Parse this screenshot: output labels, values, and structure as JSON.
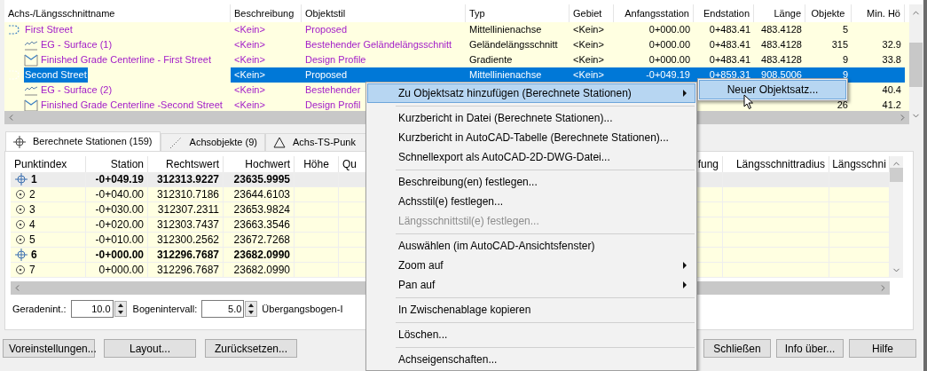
{
  "alignment_table": {
    "columns": [
      "Achs-/Längsschnittname",
      "Beschreibung",
      "Objektstil",
      "Typ",
      "Gebiet",
      "Anfangsstation",
      "Endstation",
      "Länge",
      "Objekte",
      "Min. Hö"
    ],
    "rows": [
      {
        "kind": "alignment",
        "selected": false,
        "cells": {
          "name": "First Street",
          "description": "<Kein>",
          "style": "Proposed",
          "type": "Mittellinienachse",
          "area": "<Kein>",
          "start": "0+000.00",
          "end": "0+483.41",
          "length": "483.4128",
          "objects": "5"
        },
        "children": [
          {
            "kind": "surface_profile",
            "selected": false,
            "cells": {
              "name": "EG - Surface (1)",
              "description": "<Kein>",
              "style": "Bestehender Geländelängsschnitt",
              "type": "Geländelängsschnitt",
              "area": "<Kein>",
              "start": "0+000.00",
              "end": "0+483.41",
              "length": "483.4128",
              "objects": "315",
              "min": "32.9"
            }
          },
          {
            "kind": "design_profile",
            "selected": false,
            "cells": {
              "name": "Finished Grade Centerline - First Street",
              "description": "<Kein>",
              "style": "Design Profile",
              "type": "Gradiente",
              "area": "<Kein>",
              "start": "0+000.00",
              "end": "0+483.41",
              "length": "483.4128",
              "objects": "9",
              "min": "33.8"
            }
          }
        ]
      },
      {
        "kind": "alignment",
        "selected": true,
        "cells": {
          "name": "Second Street",
          "description": "<Kein>",
          "style": "Proposed",
          "type": "Mittellinienachse",
          "area": "<Kein>",
          "start": "-0+049.19",
          "end": "0+859.31",
          "length": "908.5006",
          "objects": "9"
        },
        "children": [
          {
            "kind": "surface_profile",
            "selected": false,
            "cells": {
              "name": "EG - Surface (2)",
              "description": "<Kein>",
              "style": "Bestehender",
              "min": "40.4"
            }
          },
          {
            "kind": "design_profile",
            "selected": false,
            "cells": {
              "name": "Finished Grade Centerline -Second Street",
              "description": "<Kein>",
              "style": "Design Profil",
              "objects": "26",
              "min": "41.2"
            }
          }
        ]
      }
    ]
  },
  "tabs": [
    {
      "label": "Berechnete Stationen (159)",
      "kind": "stations",
      "selected": true
    },
    {
      "label": "Achsobjekte (9)",
      "kind": "entities",
      "selected": false
    },
    {
      "label": "Achs-TS-Punk",
      "kind": "points",
      "selected": false
    }
  ],
  "station_table": {
    "columns": [
      "Punktindex",
      "Station",
      "Rechtswert",
      "Hochwert",
      "Höhe",
      "Qu",
      "fung",
      "Längsschnittradius",
      "Längsschni"
    ],
    "rows": [
      {
        "kind": "geometry",
        "selected": true,
        "index": "1",
        "station": "-0+049.19",
        "easting": "312313.9227",
        "northing": "23635.9995"
      },
      {
        "kind": "station",
        "selected": false,
        "index": "2",
        "station": "-0+040.00",
        "easting": "312310.7186",
        "northing": "23644.6103"
      },
      {
        "kind": "station",
        "selected": false,
        "index": "3",
        "station": "-0+030.00",
        "easting": "312307.2311",
        "northing": "23653.9824"
      },
      {
        "kind": "station",
        "selected": false,
        "index": "4",
        "station": "-0+020.00",
        "easting": "312303.7437",
        "northing": "23663.3546"
      },
      {
        "kind": "station",
        "selected": false,
        "index": "5",
        "station": "-0+010.00",
        "easting": "312300.2562",
        "northing": "23672.7268"
      },
      {
        "kind": "geometry",
        "selected": false,
        "index": "6",
        "station": "-0+000.00",
        "easting": "312296.7687",
        "northing": "23682.0990"
      },
      {
        "kind": "station",
        "selected": false,
        "index": "7",
        "station": "0+000.00",
        "easting": "312296.7687",
        "northing": "23682.0990"
      }
    ]
  },
  "interval_fields": [
    {
      "kind": "spin",
      "label": "Geradenint.:",
      "value": "10.0"
    },
    {
      "kind": "spin",
      "label": "Bogenintervall:",
      "value": "5.0"
    },
    {
      "kind": "label",
      "label": "Übergangsbogen-I"
    }
  ],
  "left_buttons": [
    "Voreinstellungen...",
    "Layout...",
    "Zurücksetzen..."
  ],
  "right_buttons": [
    "Schließen",
    "Info über...",
    "Hilfe"
  ],
  "context_menu": {
    "groups": [
      [
        {
          "label": "Zu Objektsatz hinzufügen (Berechnete Stationen)",
          "submenu": true,
          "disabled": false,
          "selected": true
        }
      ],
      [
        {
          "label": "Kurzbericht in Datei (Berechnete Stationen)...",
          "submenu": false,
          "disabled": false,
          "selected": false
        },
        {
          "label": "Kurzbericht in AutoCAD-Tabelle (Berechnete Stationen)...",
          "submenu": false,
          "disabled": false,
          "selected": false
        },
        {
          "label": "Schnellexport als AutoCAD-2D-DWG-Datei...",
          "submenu": false,
          "disabled": false,
          "selected": false
        }
      ],
      [
        {
          "label": "Beschreibung(en) festlegen...",
          "submenu": false,
          "disabled": false,
          "selected": false
        },
        {
          "label": "Achsstil(e) festlegen...",
          "submenu": false,
          "disabled": false,
          "selected": false
        },
        {
          "label": "Längsschnittstil(e) festlegen...",
          "submenu": false,
          "disabled": true,
          "selected": false
        }
      ],
      [
        {
          "label": "Auswählen (im AutoCAD-Ansichtsfenster)",
          "submenu": false,
          "disabled": false,
          "selected": false
        },
        {
          "label": "Zoom auf",
          "submenu": true,
          "disabled": false,
          "selected": false
        },
        {
          "label": "Pan auf",
          "submenu": true,
          "disabled": false,
          "selected": false
        }
      ],
      [
        {
          "label": "In Zwischenablage kopieren",
          "submenu": false,
          "disabled": false,
          "selected": false
        }
      ],
      [
        {
          "label": "Löschen...",
          "submenu": false,
          "disabled": false,
          "selected": false
        }
      ],
      [
        {
          "label": "Achseigenschaften...",
          "submenu": false,
          "disabled": false,
          "selected": false
        }
      ]
    ],
    "submenu": [
      {
        "label": "Neuer Objektsatz...",
        "selected": true
      }
    ]
  }
}
